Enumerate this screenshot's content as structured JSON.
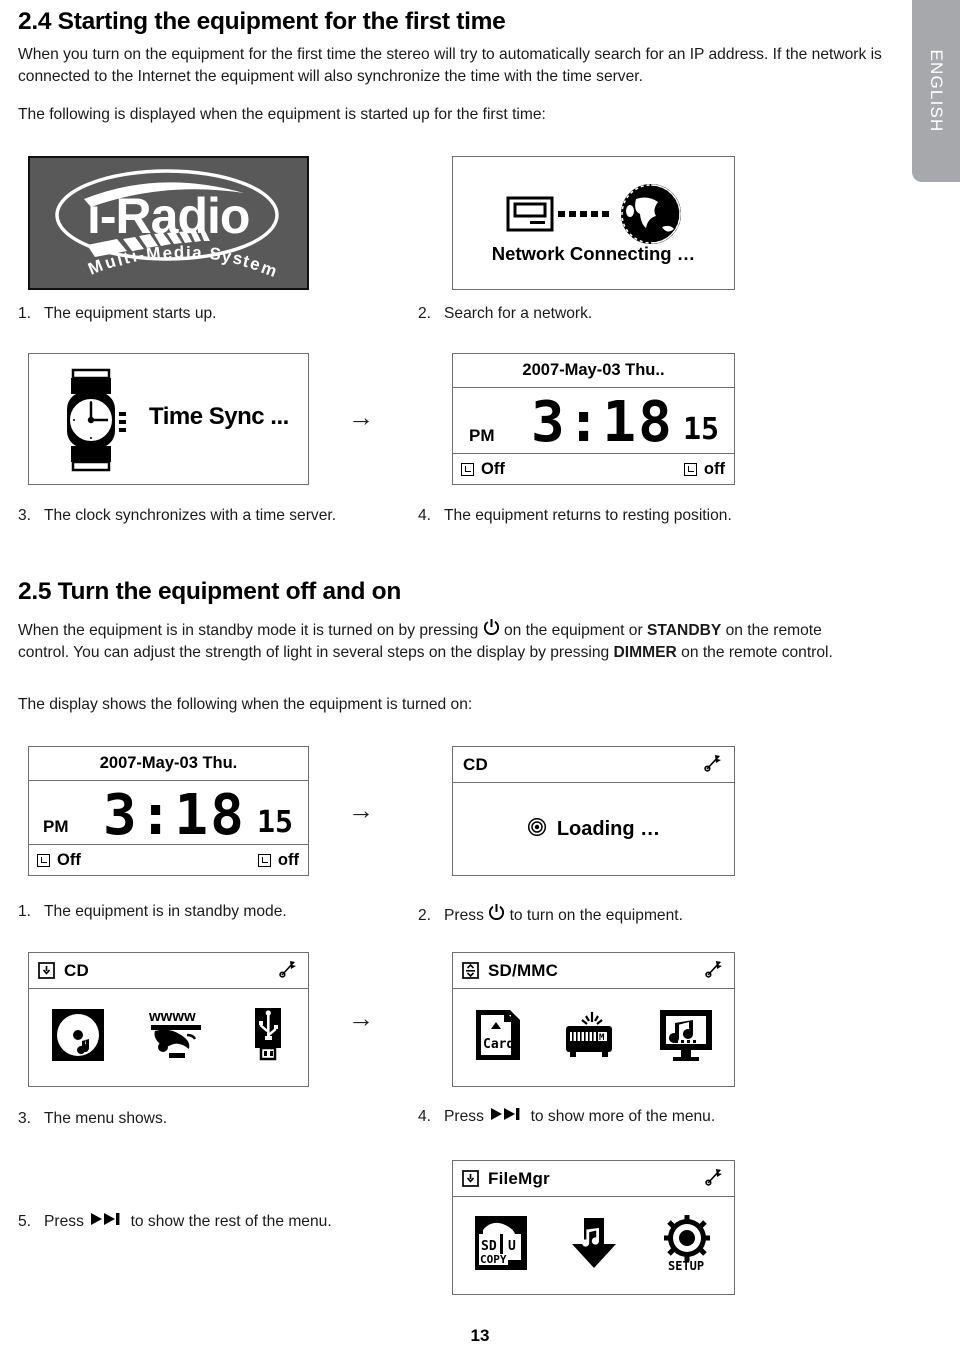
{
  "language_tab": {
    "label": "ENGLISH"
  },
  "section_24": {
    "heading": "2.4 Starting the equipment for the first time",
    "paragraph1": "When you turn on the equipment for the first time the stereo will try to automatically search for an IP address. If the network is connected to the Internet the equipment will also synchronize the time with the time server.",
    "paragraph2": "The following is displayed when the equipment is started up for the first time:",
    "steps": [
      {
        "num": "1.",
        "text": "The equipment starts up."
      },
      {
        "num": "2.",
        "text": "Search for a network."
      },
      {
        "num": "3.",
        "text": "The clock synchronizes with a time server."
      },
      {
        "num": "4.",
        "text": "The equipment returns to resting position."
      }
    ]
  },
  "splash_screen": {
    "brand": "i-Radio",
    "tagline": "Multi-Media System",
    "background_color": "#595959"
  },
  "network_screen": {
    "status_text": "Network Connecting …",
    "icons": [
      "monitor-icon",
      "dotted-link",
      "globe-icon"
    ]
  },
  "timesync_screen": {
    "status_text": "Time Sync ...",
    "icon": "wristwatch-icon"
  },
  "clock_screen_1": {
    "date": "2007-May-03 Thu..",
    "meridiem": "PM",
    "time": "3:18",
    "seconds": "15",
    "alarm_left": "Off",
    "alarm_right": "off"
  },
  "section_25": {
    "heading": "2.5 Turn the equipment off and on",
    "paragraph1_part1": "When the equipment is in standby mode it is turned on by pressing",
    "paragraph1_part2": "on the equipment or",
    "paragraph1_bold1": "STANDBY",
    "paragraph1_part3": "on the remote control. You can adjust the strength of light in several steps on the display by pressing",
    "paragraph1_bold2": "DIMMER",
    "paragraph1_part4": "on the remote control.",
    "paragraph2": "The display shows the following when the equipment is turned on:",
    "steps": [
      {
        "num": "1.",
        "text": "The equipment is in standby mode."
      },
      {
        "num": "2.",
        "text_before": "Press",
        "text_after": "to turn on the equipment.",
        "icon": "power-icon"
      },
      {
        "num": "3.",
        "text": "The menu shows."
      },
      {
        "num": "4.",
        "text_before": "Press",
        "text_after": "to show more of the menu.",
        "icon": "skip-forward-icon"
      },
      {
        "num": "5.",
        "text_before": "Press",
        "text_after": "to show the rest of the menu.",
        "icon": "skip-forward-icon"
      }
    ]
  },
  "clock_screen_2": {
    "date": "2007-May-03 Thu.",
    "meridiem": "PM",
    "time": "3:18",
    "seconds": "15",
    "alarm_left": "Off",
    "alarm_right": "off"
  },
  "loading_screen": {
    "title": "CD",
    "status_text": "Loading …",
    "status_icon": "disc-spinner-icon",
    "corner_icon": "signal-flag-icon"
  },
  "menu_cd": {
    "title": "CD",
    "title_icon": "down-arrow-box-icon",
    "corner_icon": "signal-flag-icon",
    "items": [
      "cd-music-icon",
      "www-internet-radio-icon",
      "usb-stick-icon"
    ]
  },
  "menu_sdmmc": {
    "title": "SD/MMC",
    "title_icon": "updown-arrow-box-icon",
    "corner_icon": "signal-flag-icon",
    "items": [
      "sd-card-icon",
      "fm-radio-icon",
      "media-monitor-icon"
    ]
  },
  "menu_filemgr": {
    "title": "FileMgr",
    "title_icon": "down-arrow-box-icon",
    "corner_icon": "signal-flag-icon",
    "items": [
      "sd-usb-copy-icon",
      "download-music-icon",
      "setup-gear-icon"
    ],
    "item_labels": [
      "SD U COPY",
      "",
      "SETUP"
    ]
  },
  "footer": {
    "page_number": "13"
  },
  "arrow_glyph": "→"
}
